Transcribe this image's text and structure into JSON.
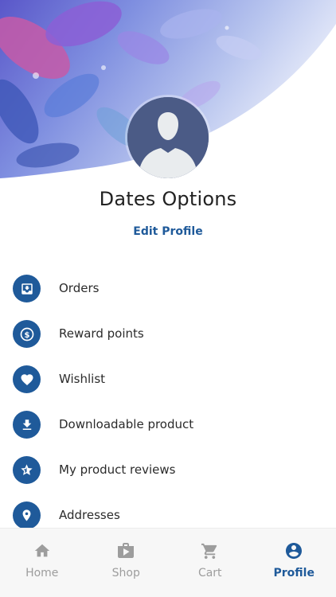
{
  "profile": {
    "name": "Dates Options",
    "edit_label": "Edit Profile"
  },
  "menu": {
    "items": [
      {
        "label": "Orders",
        "icon": "orders-inbox-icon"
      },
      {
        "label": "Reward points",
        "icon": "dollar-coin-icon"
      },
      {
        "label": "Wishlist",
        "icon": "heart-icon"
      },
      {
        "label": "Downloadable product",
        "icon": "download-icon"
      },
      {
        "label": "My product reviews",
        "icon": "star-review-icon"
      },
      {
        "label": "Addresses",
        "icon": "location-pin-icon"
      }
    ]
  },
  "nav": {
    "items": [
      {
        "label": "Home",
        "icon": "home-icon",
        "active": false
      },
      {
        "label": "Shop",
        "icon": "shop-bag-icon",
        "active": false
      },
      {
        "label": "Cart",
        "icon": "cart-icon",
        "active": false
      },
      {
        "label": "Profile",
        "icon": "account-circle-icon",
        "active": true
      }
    ]
  },
  "colors": {
    "accent": "#1f5a9a",
    "inactive_nav": "#9d9d9d",
    "avatar_bg": "#4b5b86"
  }
}
